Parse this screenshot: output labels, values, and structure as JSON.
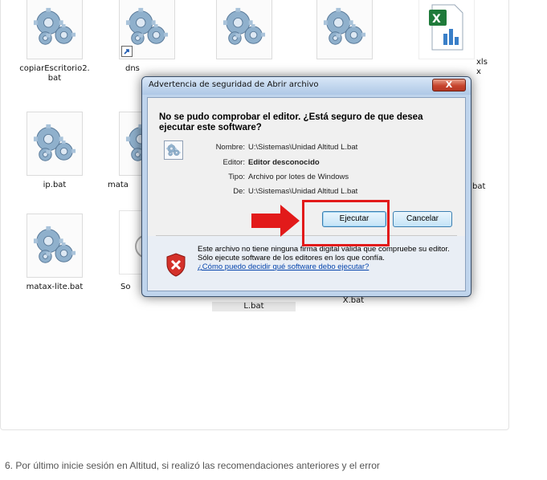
{
  "explorer": {
    "files": [
      {
        "label": "copiarEscritorio2.\nbat",
        "icon": "batch-gear-icon"
      },
      {
        "label": "dns",
        "icon": "batch-gear-icon",
        "shortcut": true
      },
      {
        "label": "",
        "icon": "batch-gear-icon"
      },
      {
        "label": "",
        "icon": "batch-gear-icon"
      },
      {
        "label": "xlsx",
        "icon": "excel-icon"
      },
      {
        "label": "ip.bat",
        "icon": "batch-gear-icon"
      },
      {
        "label": "mata",
        "icon": "batch-gear-icon"
      },
      {
        "label": "bat",
        "icon": "batch-gear-icon"
      },
      {
        "label": "matax-lite.bat",
        "icon": "batch-gear-icon"
      },
      {
        "label": "So",
        "icon": "generic-file-icon"
      },
      {
        "label": "L.bat",
        "icon": "none"
      },
      {
        "label": "X.bat",
        "icon": "none"
      }
    ]
  },
  "dialog": {
    "title": "Advertencia de seguridad de Abrir archivo",
    "close_label": "X",
    "heading": "No se pudo comprobar el editor. ¿Está seguro de que desea ejecutar este software?",
    "fields": [
      {
        "key": "Nombre:",
        "value": "U:\\Sistemas\\Unidad Altitud L.bat",
        "bold": false
      },
      {
        "key": "Editor:",
        "value": "Editor desconocido",
        "bold": true
      },
      {
        "key": "Tipo:",
        "value": "Archivo por lotes de Windows",
        "bold": false
      },
      {
        "key": "De:",
        "value": "U:\\Sistemas\\Unidad Altitud L.bat",
        "bold": false
      }
    ],
    "run_label": "Ejecutar",
    "cancel_label": "Cancelar",
    "footer_text": "Este archivo no tiene ninguna firma digital válida que compruebe su editor. Sólo ejecute software de los editores en los que confía.",
    "help_link": "¿Cómo puedo decidir qué software debo ejecutar?"
  },
  "annotation": {
    "color": "#e21a1a"
  },
  "article": {
    "paragraph": "6. Por último inicie sesión en Altitud, si realizó las recomendaciones anteriores y el error"
  }
}
